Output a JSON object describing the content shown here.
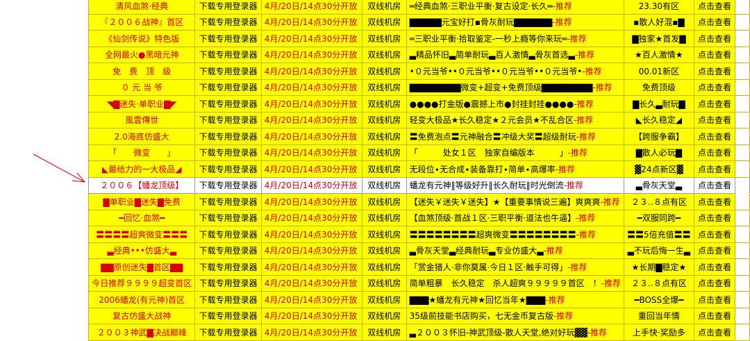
{
  "colors": {
    "row_bg": "#ffff00",
    "highlight_bg": "#ffffff",
    "name_text": "#d40000",
    "time_text": "#d40000",
    "border": "#c8b400"
  },
  "columns": {
    "login": "下载专用登录器",
    "time": "4月/20日/14点30分开放",
    "line": "双线机房",
    "view": "点击查看",
    "recommend_suffix": "-推荐"
  },
  "rows": [
    {
      "name": "清风血煞·经典",
      "desc": "═经典血煞·三职业平衡·复古设定·长久═",
      "region": "23.30有区"
    },
    {
      "name": "『２００６战神』首区",
      "desc": "▇▇▇▇▇元宝好打▪骨灰耐玩▇▇▇▇▇▇",
      "region": "▪散人好混▪▇"
    },
    {
      "name": "《仙剑传说》特色版",
      "desc": "═三职业平衡·拾取鉴定-一秒上瘾等你来玩═",
      "region": "▇独家★首发▇"
    },
    {
      "name": "全网最火●黑暗元神",
      "desc": "▃精品怀旧▃简单耐玩▃百人激情▃骨灰首选▃",
      "region": "★百人激情★"
    },
    {
      "name": "免　费　顶　级",
      "desc": "•０元当爷••０元当爷••０元当爷••０元当爷•",
      "region": "00.01新区"
    },
    {
      "name": "０ 元 当 爷",
      "desc": "▇▇▇▇▇▇▇▇微变+超变+免费顶级▇▇▇▇▇▇▇▇",
      "region": "免费顶级"
    },
    {
      "name": "◥▇迷失·单职业▇◤",
      "desc": "●●●●打金版●震撼上市●封挂封挂●●●●",
      "region": "▇长久▃耐玩▇"
    },
    {
      "name": "風雲傳世",
      "desc": "轻变大极品★长久稳定★２元会员★不乱合区",
      "region": "◣长久稳定◢"
    },
    {
      "name": "2.0海底仿盛大",
      "desc": "〓免费泡点〓元神融合〓冲级大奖〓超级耐玩",
      "region": "【跨服争霸】"
    },
    {
      "name": "「　　微变　　」",
      "desc": "「　　　处女１区　独家自编版本　　　」",
      "region": "▇散人必玩▇"
    },
    {
      "name": "◣最给力的一大极品◢",
      "desc": "无段位∙无合成∙装备靠打∙简单∙高爆率",
      "region": "▓24点新区▓"
    },
    {
      "name": "２００６【蟠龙顶级】",
      "desc": "蟠龙有元神‖等级好升‖长久耐玩‖时光倒流",
      "region": "▃骨灰天堂▃",
      "highlight": true
    },
    {
      "name": "▇单职业▇迷失▇免费",
      "desc": "【迷失￥迷失￥迷失】★【重要事情说三遍】爽爽爽",
      "region": "２３‥８点有区"
    },
    {
      "name": "━回忆·血煞━",
      "desc": "【血煞顶级·首战１区·三职平衡·道法也牛逼】",
      "region": "━双服同跨━"
    },
    {
      "name": "〓〓〓〓超爽微变〓〓〓",
      "desc": "〓〓〓〓〓〓〓〓超爽微变〓〓〓〓〓〓〓〓",
      "region": "〓〓5倍充值〓〓"
    },
    {
      "name": "▃经典•••仿盛大▃",
      "desc": "▃骨灰天堂▃经典耐玩▃专业仿盛大▃",
      "region": "▃不玩后悔一生▃"
    },
    {
      "name": "▇▇原创迷失▇首区▇▇",
      "desc": "「赏金猎人·非你莫属·今日１区·触手可得」",
      "region": "★长期▇稳定★"
    },
    {
      "name": "今日推荐９９９９超变首区",
      "desc": "简单粗暴　长久稳定　杀人超爽９９９９９首区　！",
      "region": "２３‥８点有区"
    },
    {
      "name": "2006蟠龙(有元神)首区",
      "desc": "▇▇▇★蟠龙有元神★回忆当年★▇▇▇",
      "region": "━BOSS全爆━"
    },
    {
      "name": "复古仿盛大战神",
      "desc": "35级前技能书店购买，七无金币复古版",
      "region": "重回当年情"
    },
    {
      "name": "２００３神武▇决战巅峰",
      "desc": "▃２００３怀旧-神武顶级-散人天堂,绝对好玩▓▓",
      "region": "上手快·奖励多"
    }
  ]
}
